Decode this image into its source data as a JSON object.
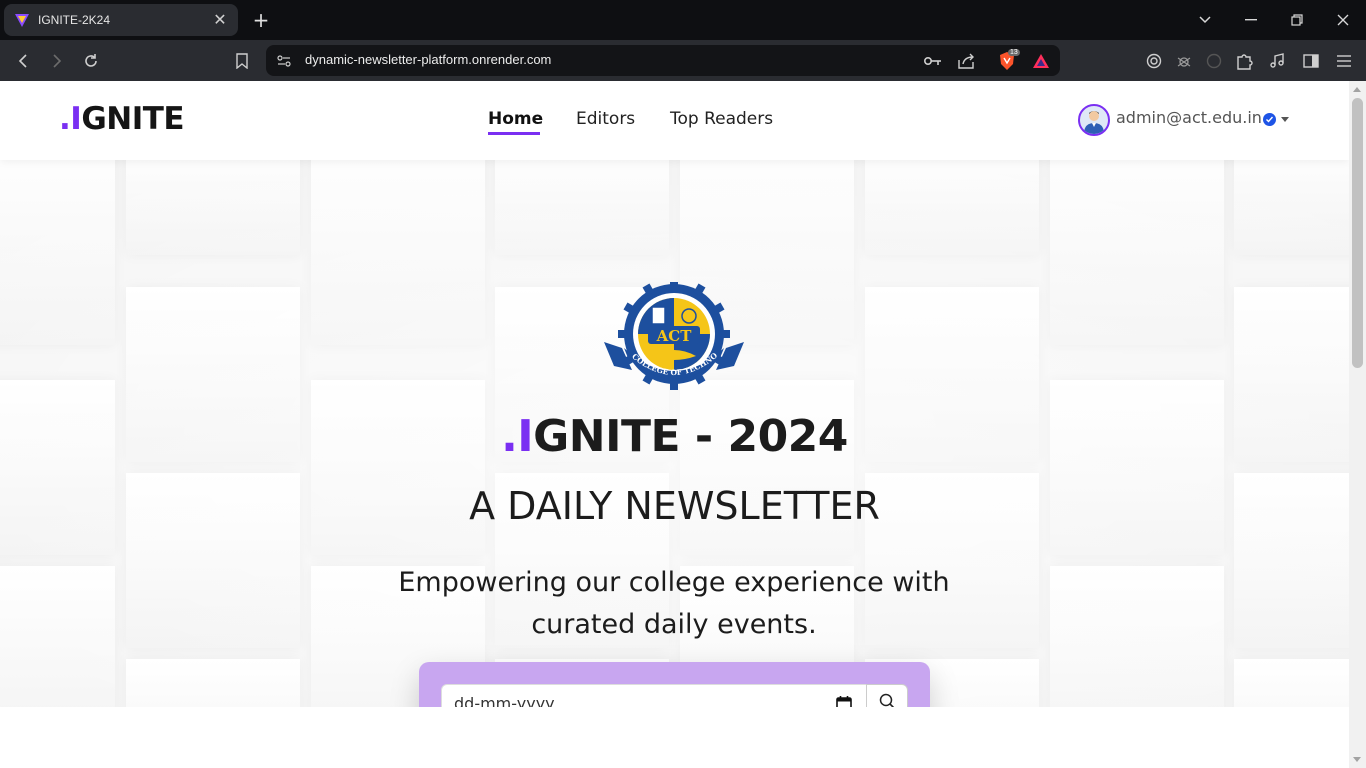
{
  "browser": {
    "tab_title": "IGNITE-2K24",
    "url": "dynamic-newsletter-platform.onrender.com",
    "brave_badge": "13",
    "icons": [
      "back-icon",
      "forward-icon",
      "reload-icon",
      "bookmark-icon",
      "site-info-icon",
      "key-icon",
      "share-icon",
      "brave-shields-icon",
      "brave-rewards-icon",
      "extension-icons",
      "puzzle-icon",
      "music-icon",
      "sidebar-icon",
      "menu-icon"
    ]
  },
  "navbar": {
    "brand_dot": ".",
    "brand_i": "I",
    "brand_rest": "GNITE",
    "links": [
      "Home",
      "Editors",
      "Top Readers"
    ],
    "active_link": "Home",
    "user_email": "admin@act.edu.in"
  },
  "hero": {
    "title_dot": ".",
    "title_i": "I",
    "title_rest": "GNITE - 2024",
    "subtitle": "A DAILY NEWSLETTER",
    "description": "Empowering our college experience with curated daily events.",
    "logo_text": "ACT",
    "logo_ring_text": "AGNI COLLEGE OF TECHNOLOGY"
  },
  "search": {
    "date_placeholder": "dd-mm-yyyy"
  },
  "colors": {
    "accent": "#7a2ff2",
    "search_card": "#c8a6f0",
    "chrome_bg": "#2a2c31"
  }
}
